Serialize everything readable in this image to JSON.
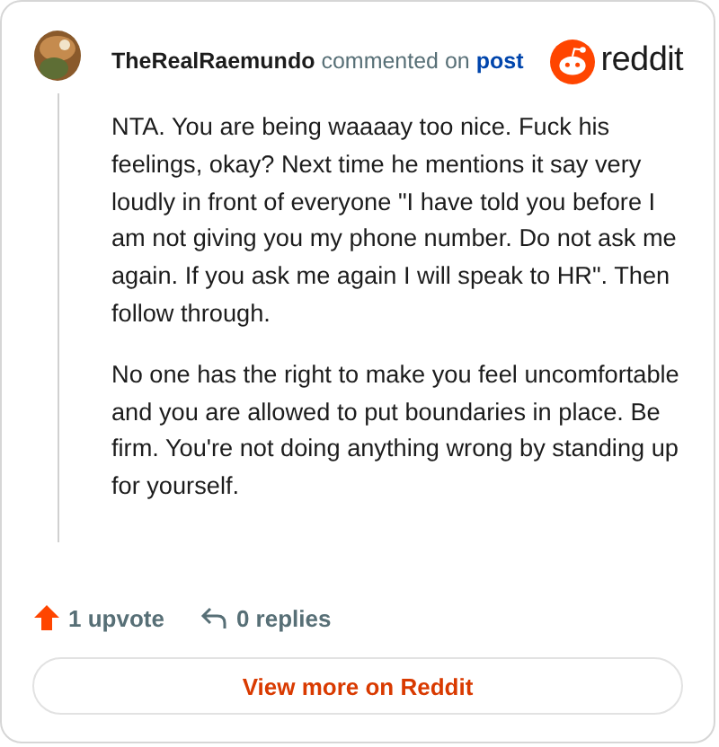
{
  "header": {
    "author": "TheRealRaemundo",
    "action": "commented on",
    "link": "post",
    "brand": "reddit"
  },
  "body": [
    "NTA. You are being waaaay too nice. Fuck his feelings, okay? Next time he mentions it say very loudly in front of everyone \"I have told you before I am not giving you my phone number. Do not ask me again. If you ask me again I will speak to HR\". Then follow through.",
    "No one has the right to make you feel uncomfortable and you are allowed to put boundaries in place. Be firm. You're not doing anything wrong by standing up for yourself."
  ],
  "footer": {
    "upvotes": "1 upvote",
    "replies": "0 replies"
  },
  "button": "View more on Reddit"
}
